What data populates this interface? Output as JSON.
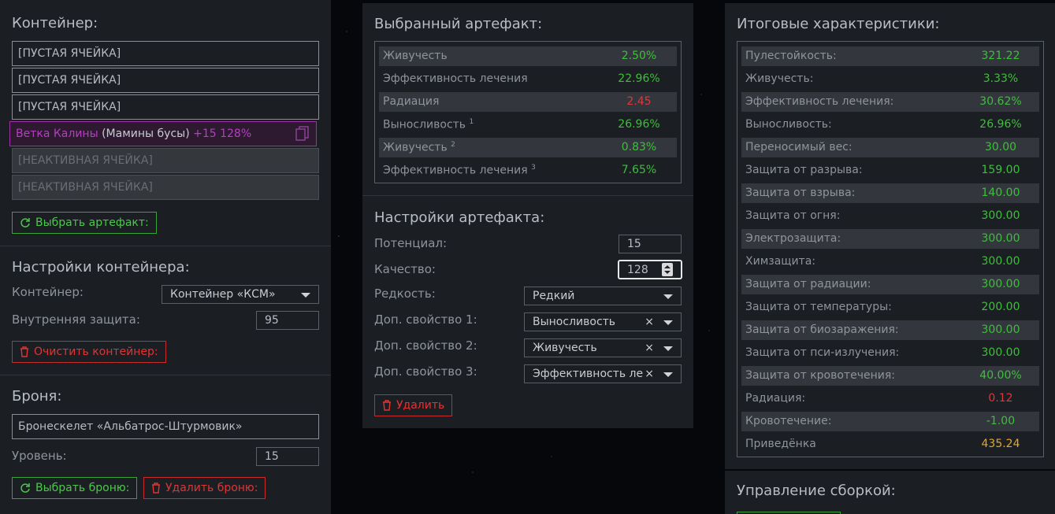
{
  "container": {
    "title": "Контейнер:",
    "cells": [
      "[ПУСТАЯ ЯЧЕЙКА]",
      "[ПУСТАЯ ЯЧЕЙКА]",
      "[ПУСТАЯ ЯЧЕЙКА]"
    ],
    "active_cell": {
      "name": "Ветка Калины",
      "sub": "(Мамины бусы)",
      "bonus": "+15 128%"
    },
    "inactive_cells": [
      "[НЕАКТИВНАЯ ЯЧЕЙКА]",
      "[НЕАКТИВНАЯ ЯЧЕЙКА]"
    ],
    "select_btn": "Выбрать артефакт:"
  },
  "container_settings": {
    "title": "Настройки контейнера:",
    "container_label": "Контейнер:",
    "container_value": "Контейнер «КСМ»",
    "protection_label": "Внутренняя защита:",
    "protection_value": "95",
    "clear_btn": "Очистить контейнер:"
  },
  "armor": {
    "title": "Броня:",
    "name": "Бронескелет «Альбатрос-Штурмовик»",
    "level_label": "Уровень:",
    "level_value": "15",
    "select_btn": "Выбрать броню:",
    "delete_btn": "Удалить броню:"
  },
  "artifact": {
    "title": "Выбранный артефакт:",
    "stats": [
      {
        "name": "Живучесть",
        "sup": "",
        "value": "2.50%",
        "color": "green"
      },
      {
        "name": "Эффективность лечения",
        "sup": "",
        "value": "22.96%",
        "color": "green"
      },
      {
        "name": "Радиация",
        "sup": "",
        "value": "2.45",
        "color": "red"
      },
      {
        "name": "Выносливость",
        "sup": "1",
        "value": "26.96%",
        "color": "green"
      },
      {
        "name": "Живучесть",
        "sup": "2",
        "value": "0.83%",
        "color": "green"
      },
      {
        "name": "Эффективность лечения",
        "sup": "3",
        "value": "7.65%",
        "color": "green"
      }
    ]
  },
  "artifact_settings": {
    "title": "Настройки артефакта:",
    "potential_label": "Потенциал:",
    "potential_value": "15",
    "quality_label": "Качество:",
    "quality_value": "128",
    "rarity_label": "Редкость:",
    "rarity_value": "Редкий",
    "prop1_label": "Доп. свойство 1:",
    "prop1_value": "Выносливость",
    "prop2_label": "Доп. свойство 2:",
    "prop2_value": "Живучесть",
    "prop3_label": "Доп. свойство 3:",
    "prop3_value": "Эффективность ле...",
    "clear_glyph": "×",
    "delete_btn": "Удалить"
  },
  "totals": {
    "title": "Итоговые характеристики:",
    "stats": [
      {
        "name": "Пулестойкость:",
        "value": "321.22",
        "color": "green"
      },
      {
        "name": "Живучесть:",
        "value": "3.33%",
        "color": "green"
      },
      {
        "name": "Эффективность лечения:",
        "value": "30.62%",
        "color": "green"
      },
      {
        "name": "Выносливость:",
        "value": "26.96%",
        "color": "green"
      },
      {
        "name": "Переносимый вес:",
        "value": "30.00",
        "color": "green"
      },
      {
        "name": "Защита от разрыва:",
        "value": "159.00",
        "color": "green"
      },
      {
        "name": "Защита от взрыва:",
        "value": "140.00",
        "color": "green"
      },
      {
        "name": "Защита от огня:",
        "value": "300.00",
        "color": "green"
      },
      {
        "name": "Электрозащита:",
        "value": "300.00",
        "color": "green"
      },
      {
        "name": "Химзащита:",
        "value": "300.00",
        "color": "green"
      },
      {
        "name": "Защита от радиации:",
        "value": "300.00",
        "color": "green"
      },
      {
        "name": "Защита от температуры:",
        "value": "200.00",
        "color": "green"
      },
      {
        "name": "Защита от биозаражения:",
        "value": "300.00",
        "color": "green"
      },
      {
        "name": "Защита от пси-излучения:",
        "value": "300.00",
        "color": "green"
      },
      {
        "name": "Защита от кровотечения:",
        "value": "40.00%",
        "color": "green"
      },
      {
        "name": "Радиация:",
        "value": "0.12",
        "color": "red"
      },
      {
        "name": "Кровотечение:",
        "value": "-1.00",
        "color": "green"
      },
      {
        "name": "Приведёнка",
        "value": "435.24",
        "color": "orange"
      }
    ]
  },
  "build": {
    "title": "Управление сборкой:"
  },
  "colors": {
    "green": "#3ebf3b",
    "red": "#d93a3a",
    "orange": "#e3a62e",
    "purple": "#b43fc0"
  }
}
